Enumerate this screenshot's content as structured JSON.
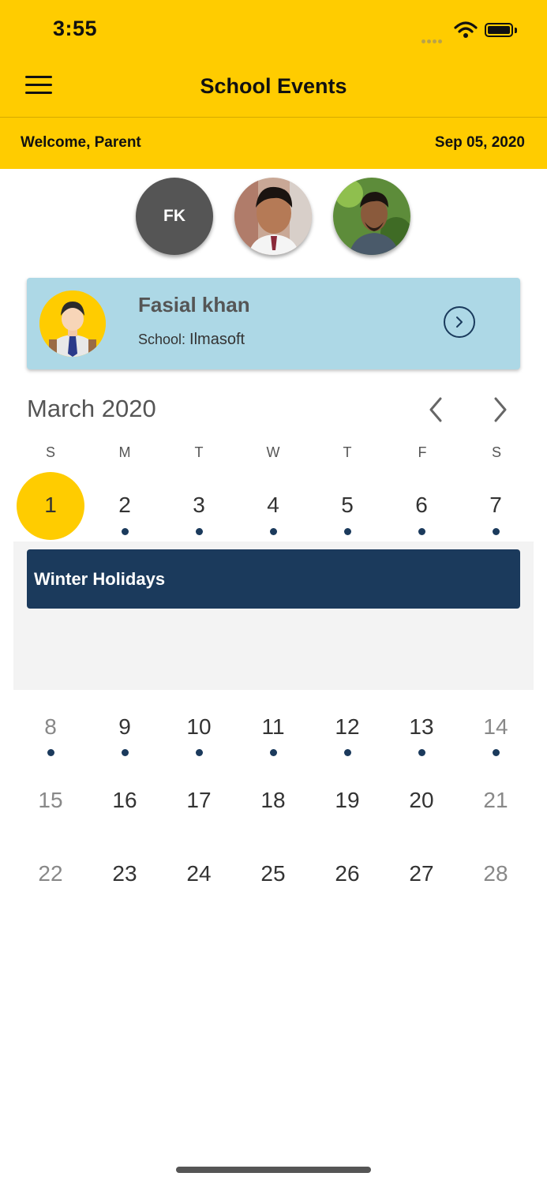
{
  "status_bar": {
    "time": "3:55"
  },
  "header": {
    "title": "School Events",
    "menu_icon": "hamburger-menu-icon"
  },
  "subheader": {
    "welcome": "Welcome, Parent",
    "date": "Sep 05, 2020"
  },
  "children": [
    {
      "initials": "FK",
      "type": "initials"
    },
    {
      "type": "photo"
    },
    {
      "type": "photo"
    }
  ],
  "student_card": {
    "name": "Fasial khan",
    "school_label": "School: ",
    "school_name": "Ilmasoft",
    "next_icon": "chevron-right-circle-icon"
  },
  "calendar": {
    "month_label": "March 2020",
    "weekdays": [
      "S",
      "M",
      "T",
      "W",
      "T",
      "F",
      "S"
    ],
    "selected_day": "1",
    "weeks": [
      [
        "1",
        "2",
        "3",
        "4",
        "5",
        "6",
        "7"
      ],
      [
        "8",
        "9",
        "10",
        "11",
        "12",
        "13",
        "14"
      ],
      [
        "15",
        "16",
        "17",
        "18",
        "19",
        "20",
        "21"
      ],
      [
        "22",
        "23",
        "24",
        "25",
        "26",
        "27",
        "28"
      ]
    ],
    "days_with_events": [
      "2",
      "3",
      "4",
      "5",
      "6",
      "7",
      "8",
      "9",
      "10",
      "11",
      "12",
      "13",
      "14"
    ]
  },
  "events": [
    {
      "title": "Winter Holidays",
      "color": "#1b3a5c"
    }
  ],
  "colors": {
    "accent": "#FFCC00",
    "card": "#ADD8E6",
    "navy": "#1b3a5c"
  }
}
